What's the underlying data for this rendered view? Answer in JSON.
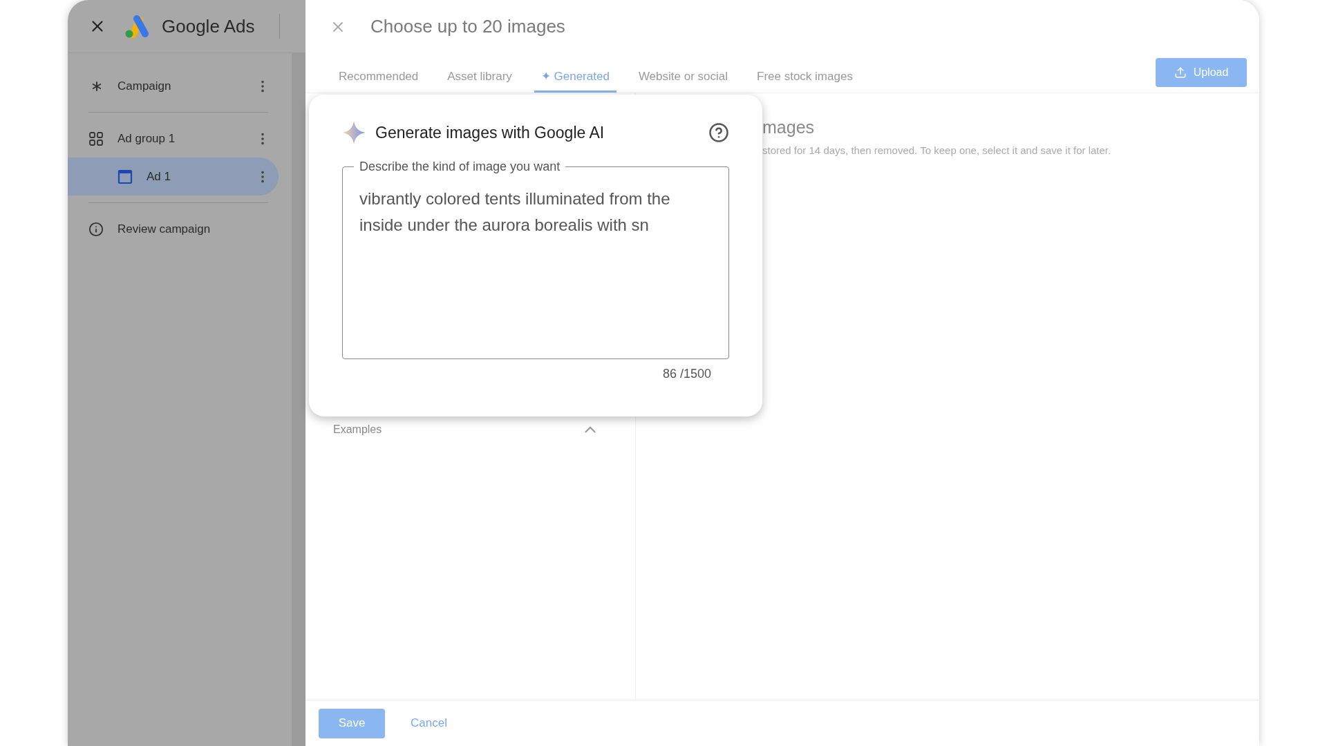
{
  "sidebar": {
    "app_title": "Google Ads",
    "items": [
      {
        "kind": "campaign",
        "label": "Campaign",
        "selected": false
      },
      {
        "kind": "ad_group",
        "label": "Ad group 1",
        "selected": false,
        "children": [
          {
            "kind": "ad",
            "label": "Ad 1",
            "selected": true
          }
        ]
      },
      {
        "kind": "review",
        "label": "Review campaign",
        "selected": false
      }
    ]
  },
  "dialog": {
    "title": "Choose up to 20 images",
    "tabs": [
      {
        "label": "Recommended",
        "selected": false
      },
      {
        "label": "Asset library",
        "selected": false
      },
      {
        "label": "✦ Generated",
        "selected": true
      },
      {
        "label": "Website or social",
        "selected": false
      },
      {
        "label": "Free stock images",
        "selected": false
      }
    ],
    "upload_button": "Upload",
    "examples_label": "Examples",
    "heading": "mages",
    "note": "stored for 14 days, then removed. To keep one, select it and save it for later.",
    "buttons": {
      "save": "Save",
      "cancel": "Cancel"
    }
  },
  "generator": {
    "title": "Generate images with Google AI",
    "field_label": "Describe the kind of image you want",
    "value": "vibrantly colored tents illuminated from the inside under the aurora borealis with sn",
    "counter": "86 /1500"
  }
}
